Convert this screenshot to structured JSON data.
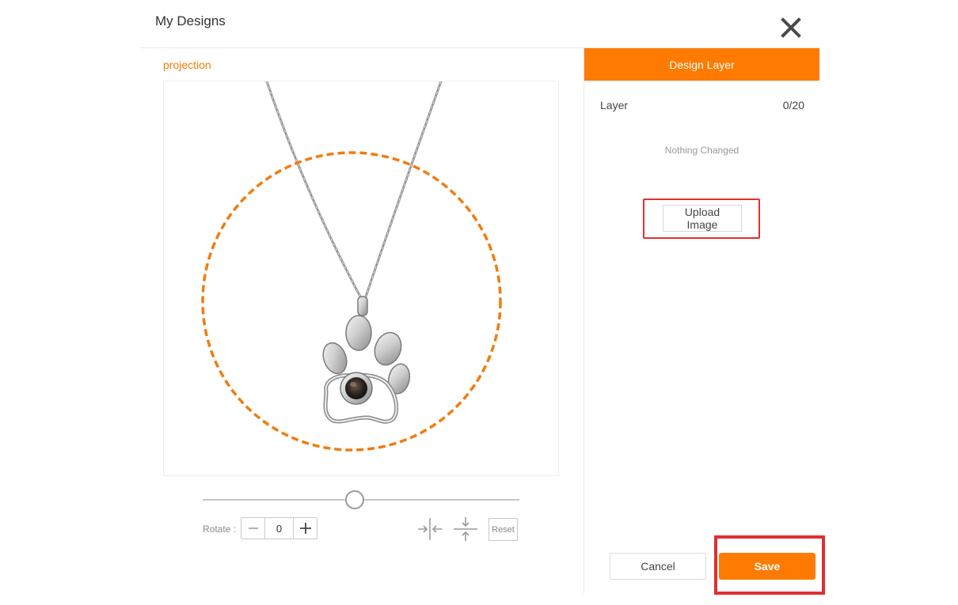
{
  "modal": {
    "title": "My Designs",
    "close_icon": "close-icon"
  },
  "editor": {
    "product_label": "projection",
    "product_image": "paw-print-projection-necklace",
    "zoom_fraction": 0.48,
    "rotate": {
      "label": "Rotate :",
      "value": "0",
      "minus_icon": "minus-icon",
      "plus_icon": "plus-icon"
    },
    "flip_horizontal_icon": "flip-horizontal-icon",
    "flip_vertical_icon": "flip-vertical-icon",
    "reset_label": "Reset"
  },
  "design_panel": {
    "tab_label": "Design Layer",
    "layer_label": "Layer",
    "layer_count": "0/20",
    "status_text": "Nothing Changed",
    "upload_label": "Upload Image"
  },
  "footer": {
    "cancel_label": "Cancel",
    "save_label": "Save"
  },
  "colors": {
    "accent": "#ff7a00",
    "highlight": "#e02f2f",
    "guide_circle": "#f07c10"
  }
}
